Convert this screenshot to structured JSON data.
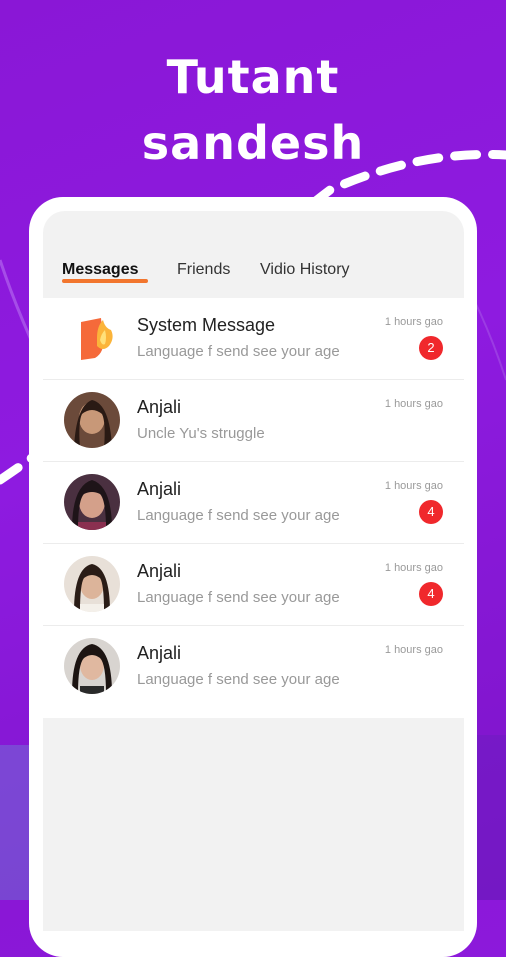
{
  "promo": {
    "title_line1": "Tutant",
    "title_line2": "sandesh"
  },
  "tabs": [
    {
      "label": "Messages",
      "active": true
    },
    {
      "label": "Friends",
      "active": false
    },
    {
      "label": "Vidio History",
      "active": false
    }
  ],
  "conversations": [
    {
      "name": "System Message",
      "preview": "Language f send see your age",
      "time": "1 hours gao",
      "unread": "2",
      "avatar": "system-flame-icon"
    },
    {
      "name": "Anjali",
      "preview": "Uncle Yu's struggle",
      "time": "1 hours gao",
      "unread": "",
      "avatar": "user-photo"
    },
    {
      "name": "Anjali",
      "preview": "Language f send see your age",
      "time": "1 hours gao",
      "unread": "4",
      "avatar": "user-photo"
    },
    {
      "name": "Anjali",
      "preview": "Language f send see your age",
      "time": "1 hours gao",
      "unread": "4",
      "avatar": "user-photo"
    },
    {
      "name": "Anjali",
      "preview": "Language f send see your age",
      "time": "1 hours gao",
      "unread": "",
      "avatar": "user-photo"
    }
  ],
  "colors": {
    "background": "#8a17d6",
    "accent_underline": "#f2762e",
    "badge": "#f0282c"
  }
}
